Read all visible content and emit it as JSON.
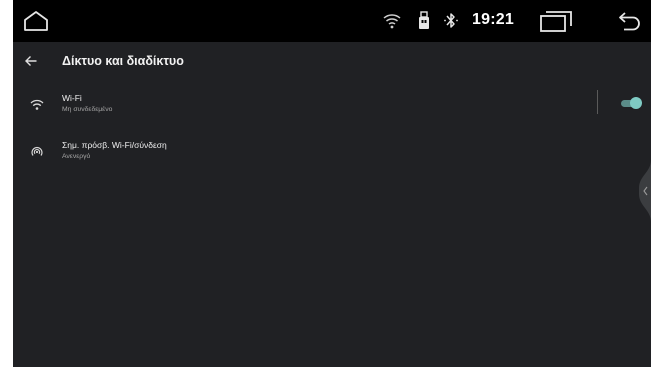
{
  "status_bar": {
    "time": "19:21",
    "icons": [
      "home-icon",
      "wifi-icon",
      "usb-icon",
      "bluetooth-icon",
      "recents-icon",
      "back-icon"
    ]
  },
  "header": {
    "title": "Δίκτυο και διαδίκτυο"
  },
  "settings": [
    {
      "title": "Wi-Fi",
      "subtitle": "Μη συνδεδεμένο",
      "icon": "wifi-icon",
      "toggle_on": true
    },
    {
      "title": "Σημ. πρόσβ. Wi-Fi/σύνδεση",
      "subtitle": "Ανενεργό",
      "icon": "hotspot-icon"
    }
  ],
  "colors": {
    "background": "#202124",
    "status_bar": "#000000",
    "accent": "#7fcbc4"
  }
}
